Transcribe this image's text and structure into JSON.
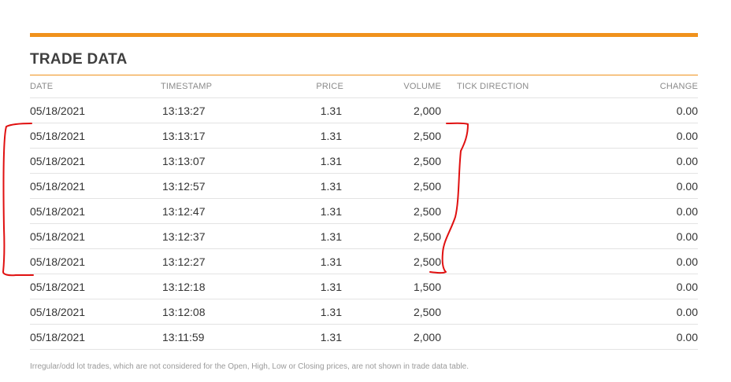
{
  "section": {
    "title": "TRADE DATA",
    "accent_color": "#f0921c"
  },
  "table": {
    "columns": [
      "DATE",
      "TIMESTAMP",
      "PRICE",
      "VOLUME",
      "TICK DIRECTION",
      "CHANGE"
    ],
    "rows": [
      {
        "date": "05/18/2021",
        "timestamp": "13:13:27",
        "price": "1.31",
        "volume": "2,000",
        "tick_direction": "",
        "change": "0.00"
      },
      {
        "date": "05/18/2021",
        "timestamp": "13:13:17",
        "price": "1.31",
        "volume": "2,500",
        "tick_direction": "",
        "change": "0.00"
      },
      {
        "date": "05/18/2021",
        "timestamp": "13:13:07",
        "price": "1.31",
        "volume": "2,500",
        "tick_direction": "",
        "change": "0.00"
      },
      {
        "date": "05/18/2021",
        "timestamp": "13:12:57",
        "price": "1.31",
        "volume": "2,500",
        "tick_direction": "",
        "change": "0.00"
      },
      {
        "date": "05/18/2021",
        "timestamp": "13:12:47",
        "price": "1.31",
        "volume": "2,500",
        "tick_direction": "",
        "change": "0.00"
      },
      {
        "date": "05/18/2021",
        "timestamp": "13:12:37",
        "price": "1.31",
        "volume": "2,500",
        "tick_direction": "",
        "change": "0.00"
      },
      {
        "date": "05/18/2021",
        "timestamp": "13:12:27",
        "price": "1.31",
        "volume": "2,500",
        "tick_direction": "",
        "change": "0.00"
      },
      {
        "date": "05/18/2021",
        "timestamp": "13:12:18",
        "price": "1.31",
        "volume": "1,500",
        "tick_direction": "",
        "change": "0.00"
      },
      {
        "date": "05/18/2021",
        "timestamp": "13:12:08",
        "price": "1.31",
        "volume": "2,500",
        "tick_direction": "",
        "change": "0.00"
      },
      {
        "date": "05/18/2021",
        "timestamp": "13:11:59",
        "price": "1.31",
        "volume": "2,000",
        "tick_direction": "",
        "change": "0.00"
      }
    ]
  },
  "footnote": "Irregular/odd lot trades, which are not considered for the Open, High, Low or Closing prices, are not shown in trade data table.",
  "annotation": {
    "color": "#e01010",
    "icon": "red-hand-drawn-brackets"
  }
}
